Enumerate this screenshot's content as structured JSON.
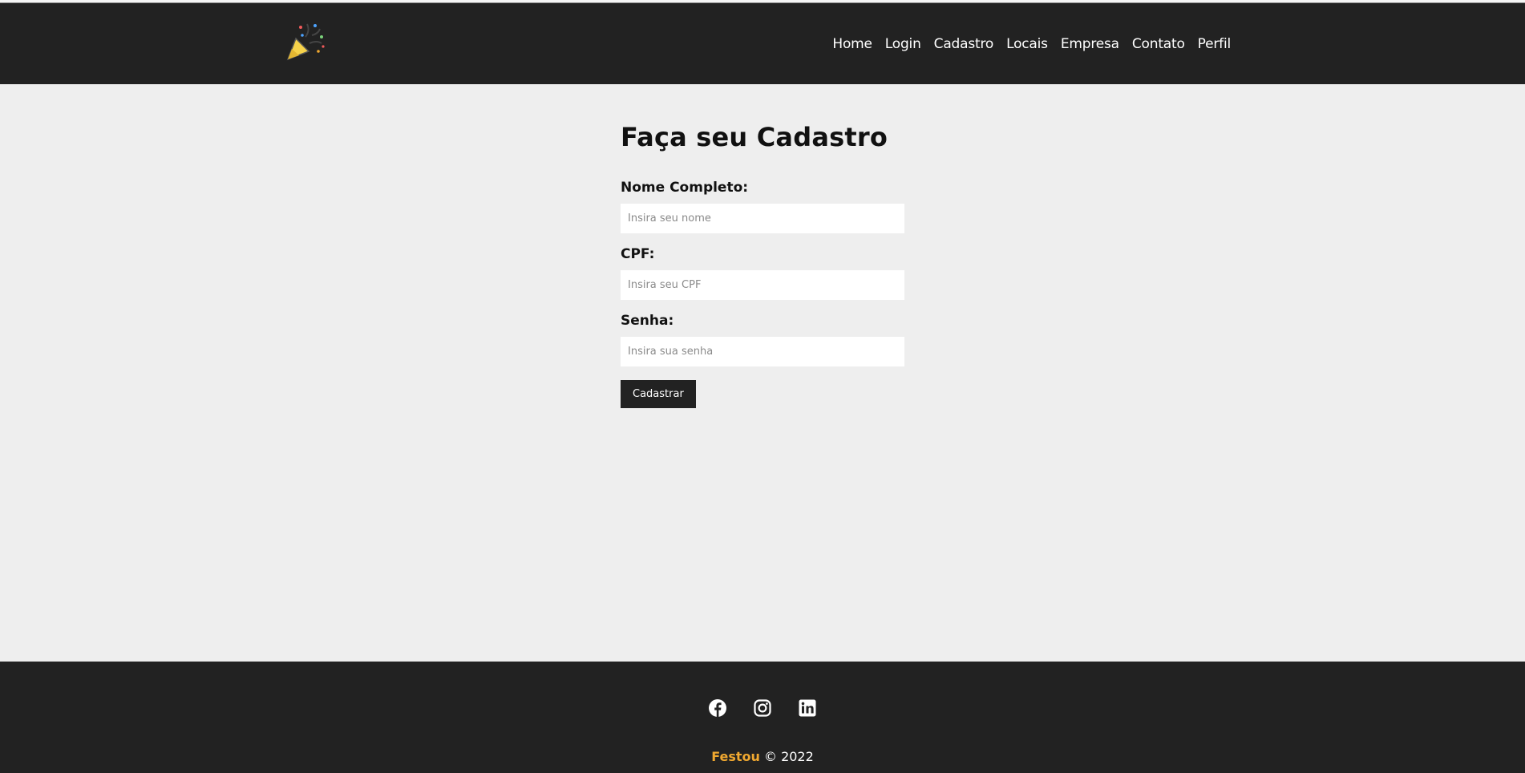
{
  "header": {
    "logo_icon": "party-popper-icon",
    "nav": [
      "Home",
      "Login",
      "Cadastro",
      "Locais",
      "Empresa",
      "Contato",
      "Perfil"
    ]
  },
  "form": {
    "title": "Faça seu Cadastro",
    "fields": [
      {
        "label": "Nome Completo:",
        "placeholder": "Insira seu nome",
        "value": ""
      },
      {
        "label": "CPF:",
        "placeholder": "Insira seu CPF",
        "value": ""
      },
      {
        "label": "Senha:",
        "placeholder": "Insira sua senha",
        "value": ""
      }
    ],
    "submit_label": "Cadastrar"
  },
  "footer": {
    "social_icons": [
      "facebook-icon",
      "instagram-icon",
      "linkedin-icon"
    ],
    "brand": "Festou",
    "copyright": "© 2022"
  },
  "colors": {
    "dark": "#222222",
    "background": "#eeeeee",
    "brand_accent": "#f0a830"
  }
}
